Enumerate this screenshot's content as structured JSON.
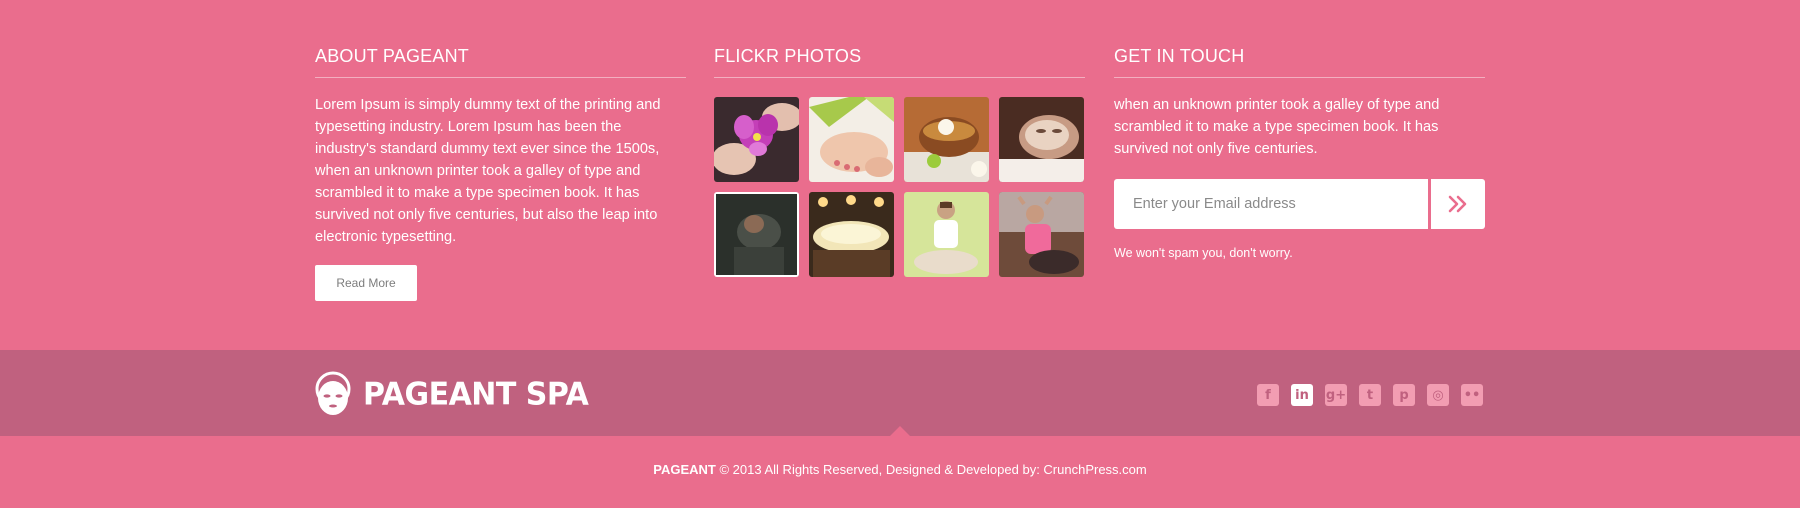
{
  "about": {
    "title": "ABOUT PAGEANT",
    "text": "Lorem Ipsum is simply dummy text of the printing and typesetting industry. Lorem Ipsum has been the industry's standard dummy text ever since the 1500s, when an unknown printer took a galley of type and scrambled it to make a type specimen book. It has survived not only five centuries, but also the leap into electronic typesetting.",
    "button_label": "Read More"
  },
  "flickr": {
    "title": "FLICKR PHOTOS",
    "photos": [
      {
        "name": "orchid-photo"
      },
      {
        "name": "foot-spa-photo"
      },
      {
        "name": "spa-bowl-photo"
      },
      {
        "name": "facial-mask-photo"
      },
      {
        "name": "man-photo"
      },
      {
        "name": "spa-pool-photo"
      },
      {
        "name": "meditation-photo"
      },
      {
        "name": "fitness-photo"
      }
    ]
  },
  "touch": {
    "title": "GET IN TOUCH",
    "text": "when an unknown printer took a galley of type and scrambled it to make a type specimen book. It has survived not only five centuries.",
    "email_placeholder": "Enter your Email address",
    "note": "We won't spam you, don't worry."
  },
  "brand": {
    "name": "PAGEANT SPA"
  },
  "socials": [
    {
      "icon": "facebook-icon",
      "glyph": "f"
    },
    {
      "icon": "linkedin-icon",
      "glyph": "in"
    },
    {
      "icon": "google-plus-icon",
      "glyph": "g+"
    },
    {
      "icon": "twitter-icon",
      "glyph": "t"
    },
    {
      "icon": "pinterest-icon",
      "glyph": "p"
    },
    {
      "icon": "instagram-icon",
      "glyph": "◎"
    },
    {
      "icon": "flickr-icon",
      "glyph": "••"
    }
  ],
  "footer": {
    "brand": "PAGEANT",
    "text": " © 2013 All Rights Reserved, Designed & Developed by: CrunchPress.com"
  },
  "colors": {
    "background": "#ea6d8d",
    "brand_bar": "#c0617f",
    "accent": "#ffffff"
  }
}
